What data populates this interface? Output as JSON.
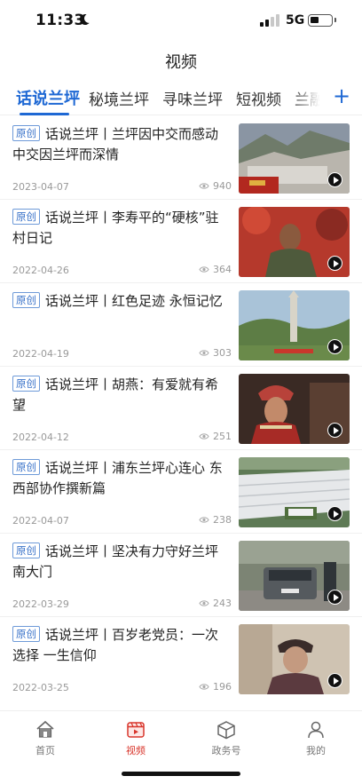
{
  "status_bar": {
    "time": "11:33",
    "network": "5G"
  },
  "header": {
    "title": "视频"
  },
  "tabs": [
    {
      "label": "话说兰坪",
      "active": true
    },
    {
      "label": "秘境兰坪"
    },
    {
      "label": "寻味兰坪"
    },
    {
      "label": "短视频"
    },
    {
      "label": "兰融"
    }
  ],
  "tab_add_label": "+",
  "news": [
    {
      "badge": "原创",
      "title": "话说兰坪丨兰坪因中交而感动 中交因兰坪而深情",
      "date": "2023-04-07",
      "views": "940",
      "thumb_icon": "mountain-town-thumbnail"
    },
    {
      "badge": "原创",
      "title": "话说兰坪丨李寿平的“硬核”驻村日记",
      "date": "2022-04-26",
      "views": "364",
      "thumb_icon": "man-portrait-thumbnail"
    },
    {
      "badge": "原创",
      "title": "话说兰坪丨红色足迹 永恒记忆",
      "date": "2022-04-19",
      "views": "303",
      "thumb_icon": "monument-thumbnail"
    },
    {
      "badge": "原创",
      "title": "话说兰坪丨胡燕：有爱就有希望",
      "date": "2022-04-12",
      "views": "251",
      "thumb_icon": "woman-headdress-thumbnail"
    },
    {
      "badge": "原创",
      "title": "话说兰坪丨浦东兰坪心连心 东西部协作撰新篇",
      "date": "2022-04-07",
      "views": "238",
      "thumb_icon": "greenhouse-thumbnail"
    },
    {
      "badge": "原创",
      "title": "话说兰坪丨坚决有力守好兰坪南大门",
      "date": "2022-03-29",
      "views": "243",
      "thumb_icon": "suv-checkpoint-thumbnail"
    },
    {
      "badge": "原创",
      "title": "话说兰坪丨百岁老党员：一次选择 一生信仰",
      "date": "2022-03-25",
      "views": "196",
      "thumb_icon": "elderly-woman-thumbnail"
    }
  ],
  "bottom_nav": [
    {
      "label": "首页",
      "icon": "home-icon"
    },
    {
      "label": "视频",
      "icon": "video-icon",
      "active": true
    },
    {
      "label": "政务号",
      "icon": "box-icon"
    },
    {
      "label": "我的",
      "icon": "user-icon"
    }
  ],
  "colors": {
    "accent": "#1e68d4",
    "nav_active": "#d8352b",
    "badge": "#3a73c9"
  }
}
